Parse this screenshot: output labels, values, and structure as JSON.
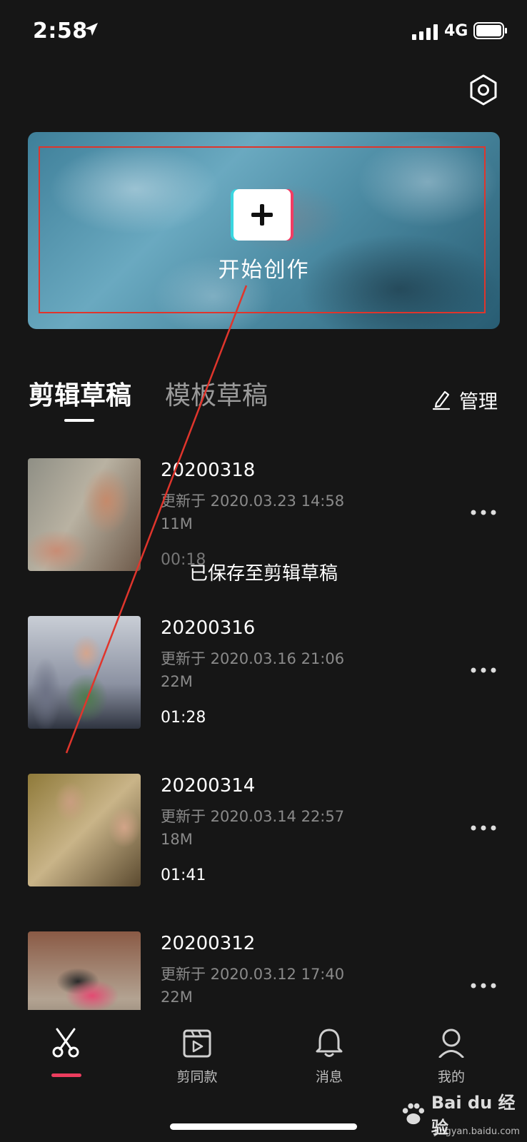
{
  "status_bar": {
    "time": "2:58",
    "network": "4G"
  },
  "banner": {
    "label": "开始创作"
  },
  "tabs": [
    {
      "label": "剪辑草稿"
    },
    {
      "label": "模板草稿"
    }
  ],
  "manage_label": "管理",
  "drafts": [
    {
      "title": "20200318",
      "updated": "更新于 2020.03.23 14:58",
      "size": "11M",
      "duration": "00:18"
    },
    {
      "title": "20200316",
      "updated": "更新于 2020.03.16 21:06",
      "size": "22M",
      "duration": "01:28"
    },
    {
      "title": "20200314",
      "updated": "更新于 2020.03.14 22:57",
      "size": "18M",
      "duration": "01:41"
    },
    {
      "title": "20200312",
      "updated": "更新于 2020.03.12 17:40",
      "size": "22M",
      "duration": ""
    }
  ],
  "toast": "已保存至剪辑草稿",
  "bottom_nav": [
    {
      "label": "",
      "icon": "scissors-icon",
      "active": true
    },
    {
      "label": "剪同款",
      "icon": "clapper-play-icon"
    },
    {
      "label": "消息",
      "icon": "bell-icon"
    },
    {
      "label": "我的",
      "icon": "person-icon"
    }
  ],
  "watermark": {
    "text": "Bai du 经验",
    "sub": "jingyan.baidu.com"
  },
  "colors": {
    "background": "#161616",
    "accent": "#ec3d5e",
    "annotation": "#e0352c"
  }
}
